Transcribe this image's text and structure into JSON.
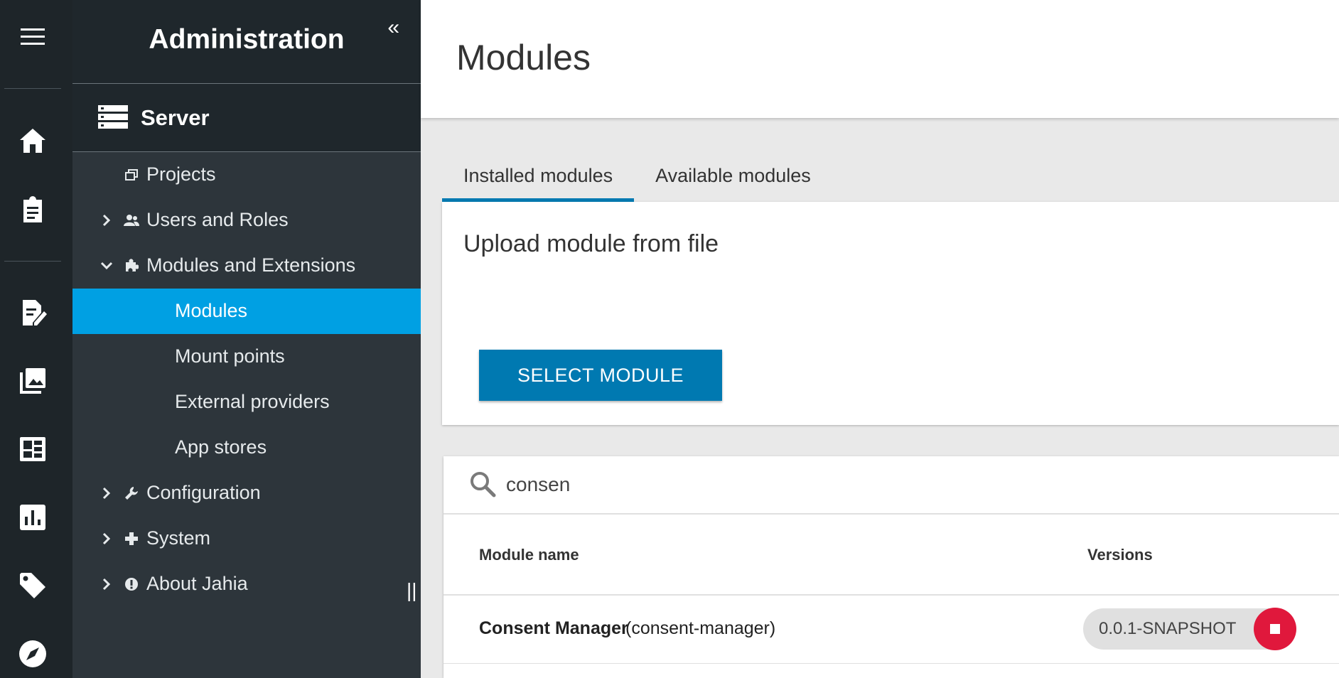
{
  "rail": {
    "icons": [
      "menu-icon",
      "home-icon",
      "clipboard-icon",
      "edit-document-icon",
      "images-icon",
      "dashboard-icon",
      "chart-icon",
      "tag-icon",
      "compass-icon"
    ]
  },
  "sidebar": {
    "title": "Administration",
    "collapse_glyph": "«",
    "section": "Server",
    "items": [
      {
        "label": "Projects",
        "icon": "projects-icon"
      },
      {
        "label": "Users and Roles",
        "icon": "users-icon"
      },
      {
        "label": "Modules and Extensions",
        "icon": "puzzle-icon"
      },
      {
        "label": "Modules"
      },
      {
        "label": "Mount points"
      },
      {
        "label": "External providers"
      },
      {
        "label": "App stores"
      },
      {
        "label": "Configuration",
        "icon": "wrench-icon"
      },
      {
        "label": "System",
        "icon": "plus-icon"
      },
      {
        "label": "About Jahia",
        "icon": "info-icon"
      }
    ],
    "grip": "||"
  },
  "main": {
    "title": "Modules",
    "tabs": [
      {
        "label": "Installed modules",
        "active": true
      },
      {
        "label": "Available modules",
        "active": false
      }
    ],
    "upload": {
      "title": "Upload module from file",
      "button": "SELECT MODULE"
    },
    "search": {
      "value": "consen"
    },
    "table": {
      "col_name": "Module name",
      "col_versions": "Versions",
      "rows": [
        {
          "name": "Consent Manager",
          "key": "(consent-manager)",
          "version": "0.0.1-SNAPSHOT"
        }
      ]
    }
  },
  "colors": {
    "rail_bg": "#1e2529",
    "sidebar_bg": "#2d353b",
    "active_item": "#00a0e3",
    "primary_button": "#0079b1",
    "stop_button": "#e0183c"
  }
}
